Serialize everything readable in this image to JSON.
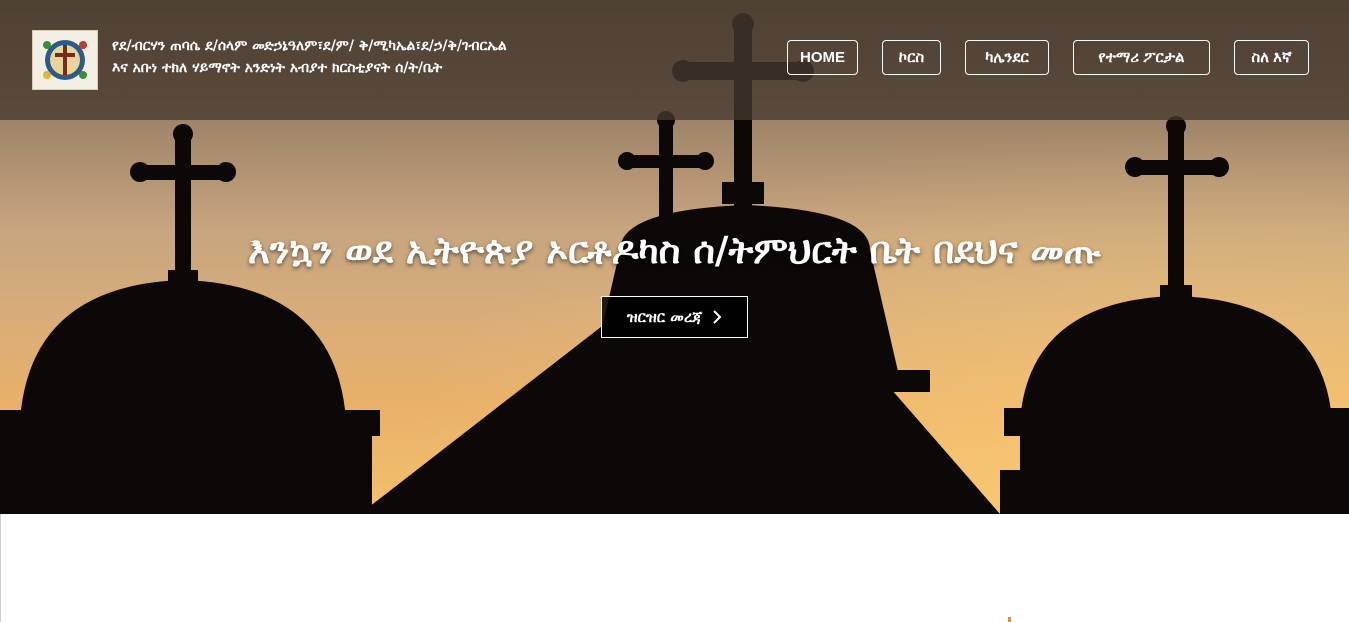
{
  "header": {
    "logo": "church-emblem-icon",
    "brand_line1": "የደ/ብርሃን ጠባሴ ደ/ሰላም መድኃኔዓለም፣ደ/ም/ ቅ/ሚካኤል፣ደ/ኃ/ቅ/ገብርኤል",
    "brand_line2": "እና አቡነ ተክለ ሃይማኖት አንድነት አብያተ ክርስቲያናት ሰ/ት/ቤት"
  },
  "nav": {
    "items": [
      "HOME",
      "ኮርስ",
      "ካሌንደር",
      "የተማሪ ፖርታል",
      "ስለ እኛ"
    ]
  },
  "hero": {
    "title": "እንኳን ወደ ኢትዮጵያ ኦርቶዶካስ ሰ/ትምህርት ቤት በደህና መጡ",
    "button_label": "ዝርዝር መረጃ",
    "button_icon": "chevron-right-icon"
  },
  "colors": {
    "header_bg": "#463a30",
    "sky_top": "#6d5a48",
    "sky_bottom": "#f3c16c",
    "accent": "#f08a24"
  }
}
